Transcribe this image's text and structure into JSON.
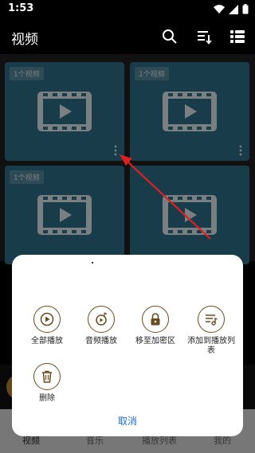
{
  "status_bar": {
    "time": "1:53",
    "icons": [
      "wifi-icon",
      "signal-icon",
      "battery-icon"
    ]
  },
  "header": {
    "title": "视频",
    "icons": [
      "search-icon",
      "sort-icon",
      "list-view-icon"
    ]
  },
  "grid": {
    "tiles": [
      {
        "count": "1个视频"
      },
      {
        "count": "1个视频"
      },
      {
        "count": "1个视频"
      },
      {
        "count": ""
      }
    ]
  },
  "sheet": {
    "actions": [
      {
        "label": "全部播放",
        "icon": "play-icon"
      },
      {
        "label": "音频播放",
        "icon": "audio-play-icon"
      },
      {
        "label": "移至加密区",
        "icon": "lock-icon"
      },
      {
        "label": "添加到播放列表",
        "icon": "playlist-add-icon"
      },
      {
        "label": "删除",
        "icon": "trash-icon"
      }
    ],
    "cancel_label": "取消"
  },
  "bottom_nav": {
    "items": [
      "视频",
      "音乐",
      "播放列表",
      "我的"
    ]
  },
  "colors": {
    "accent": "#1e6ad6",
    "tile_bg": "#2f6d87",
    "icon_stroke": "#6b4a1e",
    "arrow": "#e02020"
  }
}
